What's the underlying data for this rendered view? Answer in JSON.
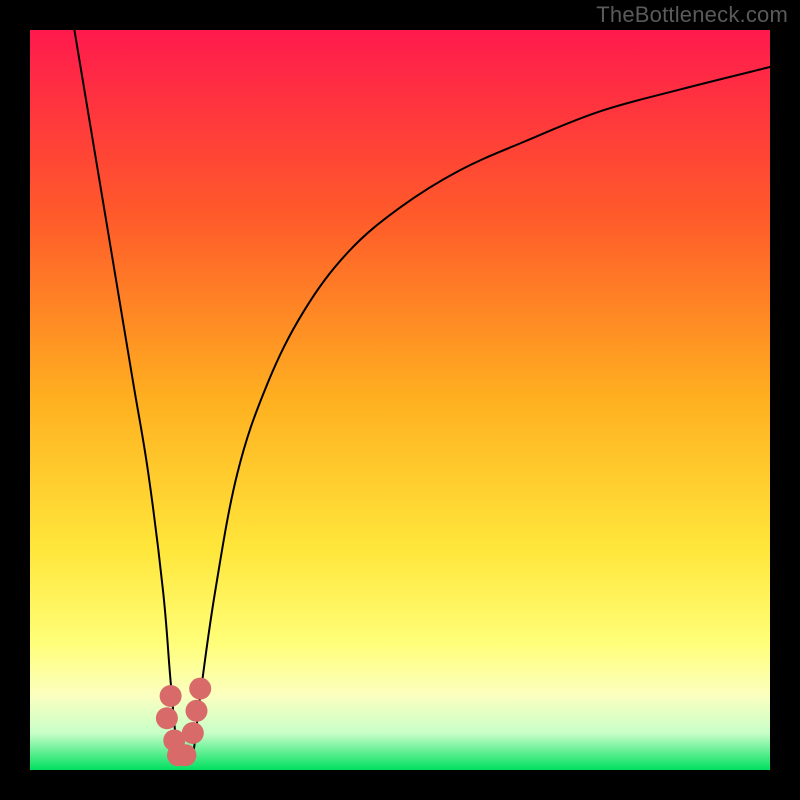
{
  "watermark": "TheBottleneck.com",
  "chart_data": {
    "type": "line",
    "title": "",
    "xlabel": "",
    "ylabel": "",
    "xlim": [
      0,
      100
    ],
    "ylim": [
      0,
      100
    ],
    "grid": false,
    "legend": false,
    "series": [
      {
        "name": "curve",
        "x": [
          6,
          8,
          10,
          12,
          14,
          16,
          18,
          19,
          20,
          21,
          22,
          23,
          25,
          28,
          32,
          37,
          43,
          50,
          58,
          67,
          77,
          88,
          100
        ],
        "values": [
          100,
          88,
          76,
          64,
          52,
          40,
          24,
          12,
          2,
          1,
          2,
          10,
          24,
          40,
          52,
          62,
          70,
          76,
          81,
          85,
          89,
          92,
          95
        ]
      }
    ],
    "markers": {
      "name": "optimum-cluster",
      "color": "#d86a6a",
      "x": [
        18.5,
        19.5,
        20.0,
        21.0,
        22.0,
        22.5,
        19.0,
        23.0
      ],
      "values": [
        7,
        4,
        2,
        2,
        5,
        8,
        10,
        11
      ]
    },
    "background_gradient": {
      "stops": [
        {
          "offset": 0.0,
          "color": "#ff1a4d"
        },
        {
          "offset": 0.25,
          "color": "#ff5a2a"
        },
        {
          "offset": 0.5,
          "color": "#ffb020"
        },
        {
          "offset": 0.7,
          "color": "#ffe63a"
        },
        {
          "offset": 0.83,
          "color": "#ffff7a"
        },
        {
          "offset": 0.9,
          "color": "#fbffc0"
        },
        {
          "offset": 0.95,
          "color": "#c8ffc8"
        },
        {
          "offset": 1.0,
          "color": "#00e060"
        }
      ]
    }
  }
}
